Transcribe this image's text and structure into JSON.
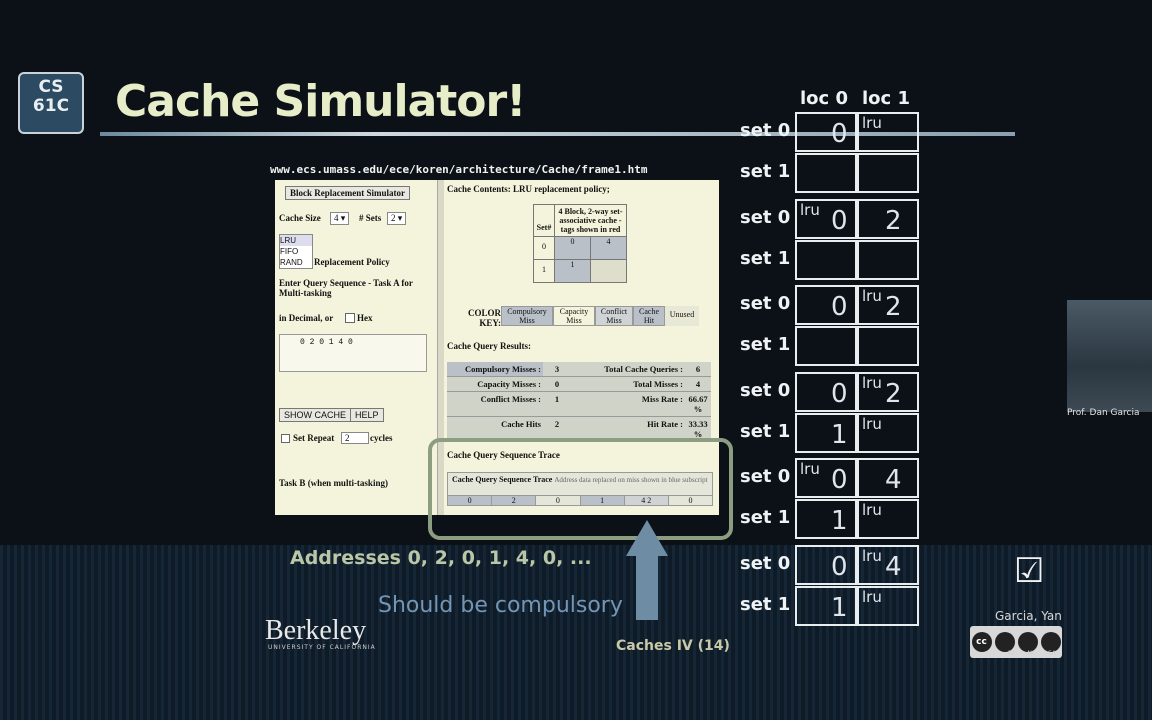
{
  "slide": {
    "title": "Cache Simulator!",
    "logo_text_line1": "CS",
    "logo_text_line2": "61C",
    "url": "www.ecs.umass.edu/ece/koren/architecture/Cache/frame1.htm",
    "addresses": "Addresses 0, 2, 0, 1, 4, 0, ...",
    "note": "Should be compulsory",
    "footer_lecture": "Caches IV (14)",
    "footer_author": "Garcia, Yan",
    "university": "Berkeley",
    "university_sub": "UNIVERSITY OF CALIFORNIA",
    "cc_labels": [
      "BY",
      "NC",
      "SA"
    ],
    "checkmark": "☑",
    "video_caption": "Prof. Dan Garcia"
  },
  "simulator": {
    "block_button": "Block Replacement Simulator",
    "cache_size_label": "Cache Size",
    "cache_size_value": "4",
    "sets_label": "# Sets",
    "sets_value": "2",
    "policies": [
      "LRU",
      "FIFO",
      "RAND"
    ],
    "policy_label": "Replacement Policy",
    "query_label": "Enter Query Sequence - Task A for Multi-tasking",
    "decimal_label": "in Decimal, or",
    "hex_label": "Hex",
    "query_value": "0 2 0 1 4 0",
    "show_cache": "SHOW CACHE",
    "help": "HELP",
    "set_repeat": "Set Repeat",
    "repeat_value": "2",
    "cycles": "cycles",
    "task_b": "Task B (when multi-tasking)",
    "contents_title": "Cache Contents: LRU replacement policy;",
    "table_header_set": "Set#",
    "table_header_desc": "4 Block, 2-way set-associative cache - tags shown in red",
    "table_rows": [
      {
        "set": "0",
        "c1": "0",
        "c2": "4"
      },
      {
        "set": "1",
        "c1": "1",
        "c2": ""
      }
    ],
    "color_key_label": "COLOR KEY:",
    "color_key": [
      "Compulsory Miss",
      "Capacity Miss",
      "Conflict Miss",
      "Cache Hit",
      "Unused"
    ],
    "results_title": "Cache Query Results:",
    "results": [
      {
        "label": "Compulsory Misses :",
        "value": "3",
        "label2": "Total Cache Queries :",
        "value2": "6"
      },
      {
        "label": "Capacity Misses :",
        "value": "0",
        "label2": "Total Misses :",
        "value2": "4"
      },
      {
        "label": "Conflict Misses :",
        "value": "1",
        "label2": "Miss Rate :",
        "value2": "66.67 %"
      },
      {
        "label": "Cache Hits",
        "value": "2",
        "label2": "Hit Rate :",
        "value2": "33.33 %"
      }
    ],
    "trace_title": "Cache Query Sequence Trace",
    "trace_header": "Cache Query Sequence Trace",
    "trace_note": "Address data replaced on miss shown in blue subscript",
    "trace_values": [
      "0",
      "2",
      "0",
      "1",
      "4 2",
      "0"
    ]
  },
  "diagram": {
    "col_headers": [
      "loc 0",
      "loc 1"
    ],
    "set0_label": "set 0",
    "set1_label": "set 1",
    "lru_label": "lru",
    "states": [
      {
        "s0": [
          "0",
          ""
        ],
        "s1": [
          "",
          ""
        ],
        "lru_s0": "loc1",
        "lru_s1": ""
      },
      {
        "s0": [
          "0",
          "2"
        ],
        "s1": [
          "",
          ""
        ],
        "lru_s0": "loc0",
        "lru_s1": ""
      },
      {
        "s0": [
          "0",
          "2"
        ],
        "s1": [
          "",
          ""
        ],
        "lru_s0": "loc1",
        "lru_s1": ""
      },
      {
        "s0": [
          "0",
          "2"
        ],
        "s1": [
          "1",
          ""
        ],
        "lru_s0": "loc1",
        "lru_s1": "loc1"
      },
      {
        "s0": [
          "0",
          "4"
        ],
        "s1": [
          "1",
          ""
        ],
        "lru_s0": "loc0",
        "lru_s1": "loc1"
      },
      {
        "s0": [
          "0",
          "4"
        ],
        "s1": [
          "1",
          ""
        ],
        "lru_s0": "loc1",
        "lru_s1": "loc1"
      }
    ]
  }
}
